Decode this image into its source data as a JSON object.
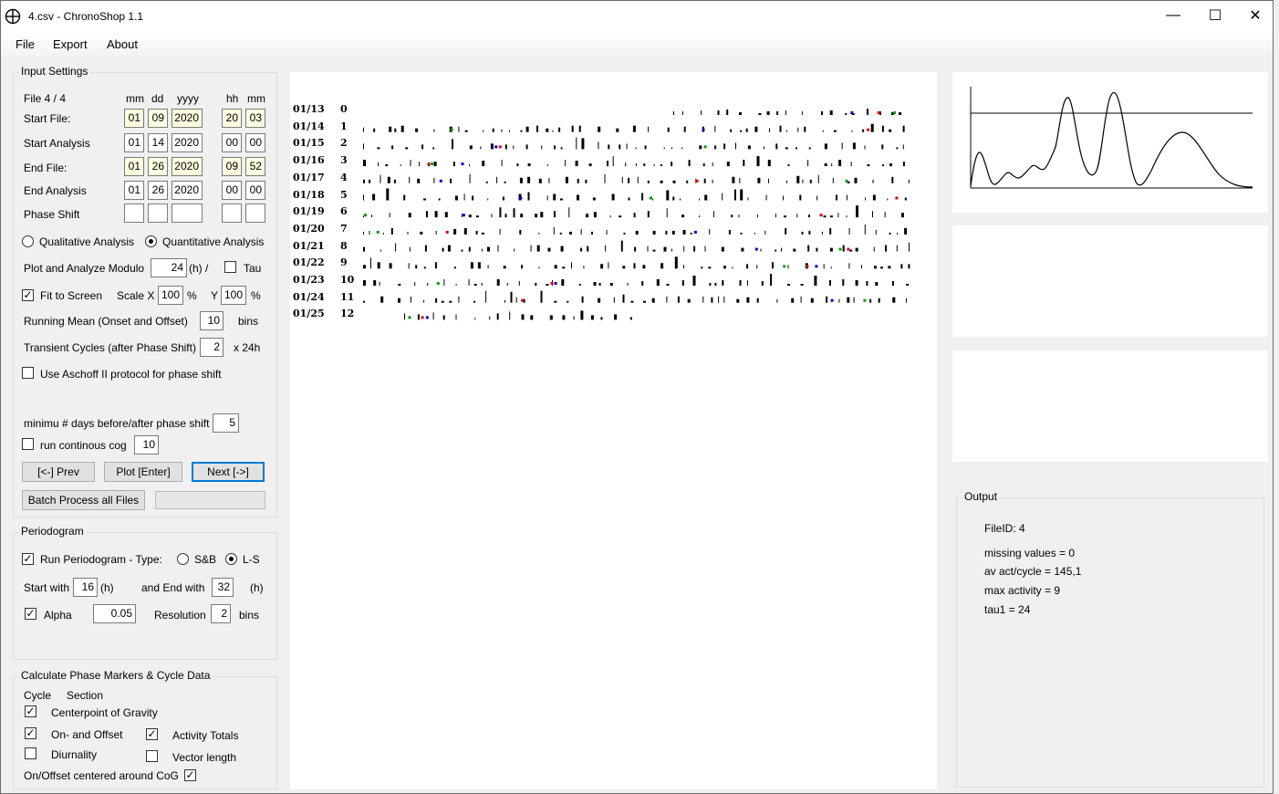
{
  "window": {
    "title": "4.csv - ChronoShop 1.1",
    "minimize_glyph": "—",
    "maximize_glyph": "☐",
    "close_glyph": "✕"
  },
  "menu": [
    "File",
    "Export",
    "About"
  ],
  "input_settings": {
    "legend": "Input Settings",
    "file_label": "File  4 / 4",
    "col_mm": "mm",
    "col_dd": "dd",
    "col_yyyy": "yyyy",
    "col_hh": "hh",
    "col_min": "mm",
    "rows": [
      {
        "label": "Start File:",
        "mm": "01",
        "dd": "09",
        "yyyy": "2020",
        "hh": "20",
        "min": "03"
      },
      {
        "label": "Start Analysis",
        "mm": "01",
        "dd": "14",
        "yyyy": "2020",
        "hh": "00",
        "min": "00"
      },
      {
        "label": "End File:",
        "mm": "01",
        "dd": "26",
        "yyyy": "2020",
        "hh": "09",
        "min": "52"
      },
      {
        "label": "End Analysis",
        "mm": "01",
        "dd": "26",
        "yyyy": "2020",
        "hh": "00",
        "min": "00"
      },
      {
        "label": "Phase Shift",
        "mm": "",
        "dd": "",
        "yyyy": "",
        "hh": "",
        "min": ""
      }
    ],
    "qualitative_label": "Qualitative Analysis",
    "quantitative_label": "Quantitative Analysis",
    "analysis_mode": "quantitative",
    "modulo_label": "Plot and Analyze Modulo",
    "modulo_value": "24",
    "modulo_unit": "(h) /",
    "tau_label": "Tau",
    "tau_checked": false,
    "fit_label": "Fit to Screen",
    "fit_checked": true,
    "scale_x_label": "Scale X",
    "scale_x_value": "100",
    "pct1": "%",
    "scale_y_label": "Y",
    "scale_y_value": "100",
    "pct2": "%",
    "running_mean_label": "Running Mean (Onset and Offset)",
    "running_mean_value": "10",
    "running_mean_unit": "bins",
    "transient_label": "Transient Cycles (after Phase Shift)",
    "transient_value": "2",
    "transient_unit": "x 24h",
    "aschoff_label": "Use Aschoff II protocol for phase shift",
    "aschoff_checked": false,
    "min_days_label": "minimu # days before/after phase shift",
    "min_days_value": "5",
    "cog_label": "run continous cog",
    "cog_checked": false,
    "cog_value": "10",
    "prev_label": "[<-]  Prev",
    "plot_label": "Plot [Enter]",
    "next_label": "Next [->]",
    "batch_label": "Batch Process all Files"
  },
  "periodogram": {
    "legend": "Periodogram",
    "run_label": "Run Periodogram - Type:",
    "run_checked": true,
    "sb_label": "S&B",
    "ls_label": "L-S",
    "type": "L-S",
    "start_label": "Start with",
    "start_value": "16",
    "start_unit": "(h)",
    "end_label": "and End with",
    "end_value": "32",
    "end_unit": "(h)",
    "alpha_label": "Alpha",
    "alpha_checked": true,
    "alpha_value": "0.05",
    "resolution_label": "Resolution",
    "resolution_value": "2",
    "resolution_unit": "bins"
  },
  "phase_markers": {
    "legend": "Calculate Phase Markers & Cycle Data",
    "cycle_label": "Cycle",
    "section_label": "Section",
    "cog_label": "Centerpoint of Gravity",
    "cog_checked": true,
    "onoff_label": "On- and Offset",
    "onoff_checked": true,
    "totals_label": "Activity Totals",
    "totals_checked": true,
    "diurnality_label": "Diurnality",
    "diurnality_checked": false,
    "vector_label": "Vector length",
    "vector_checked": false,
    "centered_label": "On/Offset centered around CoG",
    "centered_checked": true
  },
  "actogram": {
    "rows": [
      {
        "date": "01/13",
        "index": "0"
      },
      {
        "date": "01/14",
        "index": "1"
      },
      {
        "date": "01/15",
        "index": "2"
      },
      {
        "date": "01/16",
        "index": "3"
      },
      {
        "date": "01/17",
        "index": "4"
      },
      {
        "date": "01/18",
        "index": "5"
      },
      {
        "date": "01/19",
        "index": "6"
      },
      {
        "date": "01/20",
        "index": "7"
      },
      {
        "date": "01/21",
        "index": "8"
      },
      {
        "date": "01/22",
        "index": "9"
      },
      {
        "date": "01/23",
        "index": "10"
      },
      {
        "date": "01/24",
        "index": "11"
      },
      {
        "date": "01/25",
        "index": "12"
      }
    ],
    "marker_colors": {
      "onset": "#00a000",
      "offset": "#e00000",
      "cog": "#0000e0",
      "activity": "#000000"
    }
  },
  "output": {
    "legend": "Output",
    "file_id": "FileID: 4",
    "missing": "missing values = 0",
    "av_act": "av act/cycle = 145,1",
    "max_act": "max activity = 9",
    "tau": "tau1 = 24"
  }
}
